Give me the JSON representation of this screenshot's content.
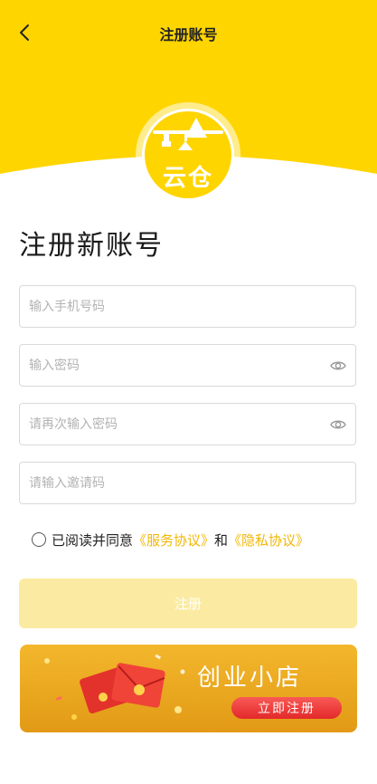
{
  "nav": {
    "title": "注册账号"
  },
  "logo": {
    "text": "云仓"
  },
  "page": {
    "title": "注册新账号"
  },
  "form": {
    "phone": {
      "placeholder": "输入手机号码",
      "value": ""
    },
    "password": {
      "placeholder": "输入密码",
      "value": ""
    },
    "password_confirm": {
      "placeholder": "请再次输入密码",
      "value": ""
    },
    "invite": {
      "placeholder": "请输入邀请码",
      "value": ""
    }
  },
  "agreement": {
    "prefix": "已阅读并同意",
    "service_link": "《服务协议》",
    "and": "和",
    "privacy_link": "《隐私协议》",
    "checked": false
  },
  "register_button": {
    "label": "注册"
  },
  "banner": {
    "title": "创业小店",
    "cta": "立即注册"
  },
  "colors": {
    "brand": "#FFD500",
    "link": "#F2B705",
    "button_disabled": "#FBEBA2"
  },
  "icons": {
    "back": "chevron-left-icon",
    "eye": "eye-icon"
  }
}
